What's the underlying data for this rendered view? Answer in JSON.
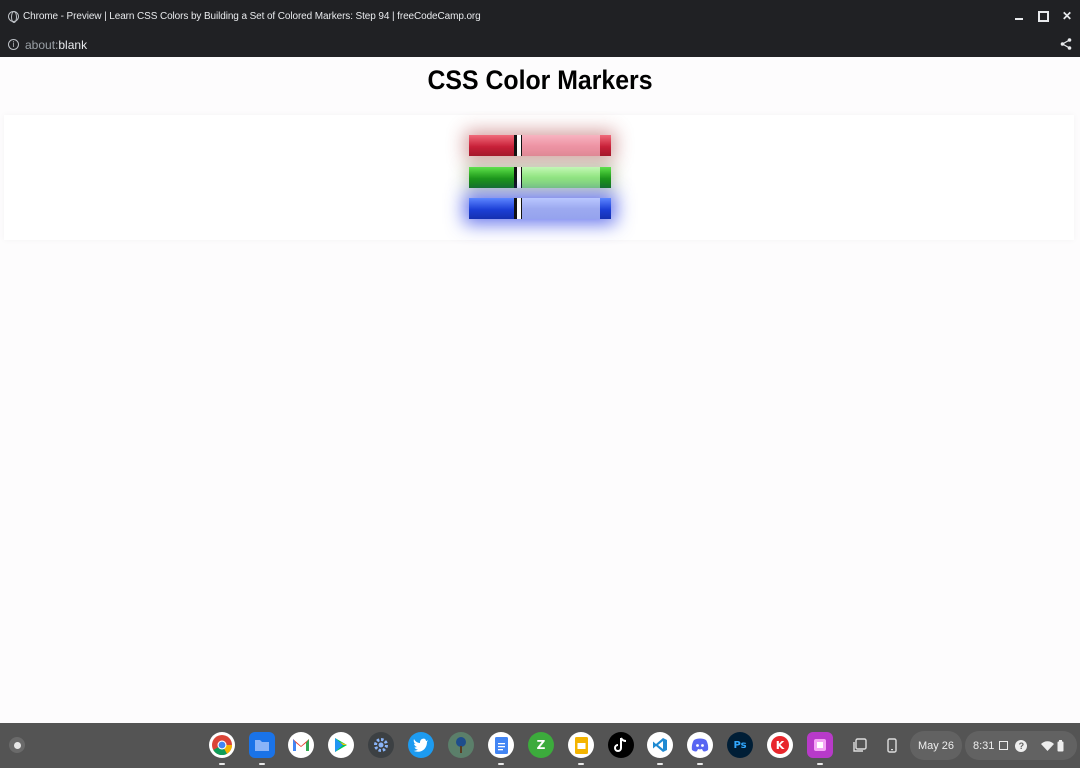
{
  "window": {
    "title": "Chrome - Preview | Learn CSS Colors by Building a Set of Colored Markers: Step 94 | freeCodeCamp.org"
  },
  "addressbar": {
    "url_scheme": "about:",
    "url_rest": "blank"
  },
  "page": {
    "heading": "CSS Color Markers",
    "markers": [
      {
        "color": "red",
        "cap": "#c9223a",
        "sleeve": "#ee95a5"
      },
      {
        "color": "green",
        "cap": "#1d9a16",
        "sleeve": "#93e87f"
      },
      {
        "color": "blue",
        "cap": "#1c3fd6",
        "sleeve": "#9daaf0"
      }
    ]
  },
  "shelf": {
    "apps": [
      {
        "name": "Chrome",
        "icon": "chrome-icon"
      },
      {
        "name": "Files",
        "icon": "files-icon"
      },
      {
        "name": "Gmail",
        "icon": "gmail-icon"
      },
      {
        "name": "Play Store",
        "icon": "play-store-icon"
      },
      {
        "name": "Settings",
        "icon": "settings-icon"
      },
      {
        "name": "Twitter",
        "icon": "twitter-icon"
      },
      {
        "name": "Tree app",
        "icon": "tree-icon"
      },
      {
        "name": "Docs",
        "icon": "docs-icon"
      },
      {
        "name": "Green app",
        "icon": "green-app-icon"
      },
      {
        "name": "Slides",
        "icon": "slides-icon"
      },
      {
        "name": "TikTok",
        "icon": "tiktok-icon"
      },
      {
        "name": "VS Code",
        "icon": "vscode-icon"
      },
      {
        "name": "Discord",
        "icon": "discord-icon"
      },
      {
        "name": "Photoshop",
        "icon": "photoshop-icon",
        "label": "Ps"
      },
      {
        "name": "KineMaster",
        "icon": "kinemaster-icon"
      },
      {
        "name": "Pink app",
        "icon": "pink-app-icon"
      }
    ],
    "date": "May 26",
    "time": "8:31"
  }
}
